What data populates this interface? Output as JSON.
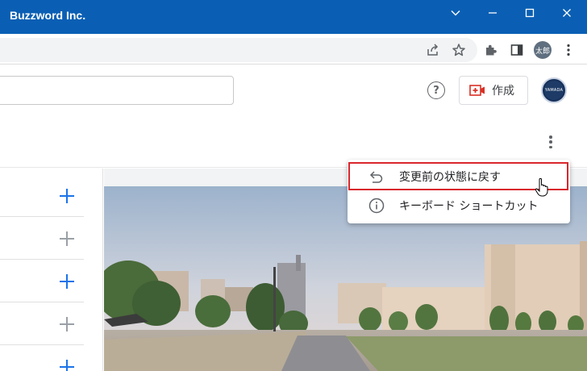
{
  "window": {
    "title": "Buzzword Inc."
  },
  "browser": {
    "profile_label": "太郎"
  },
  "header": {
    "create_label": "作成",
    "help_symbol": "?",
    "account_text": "YAMADA"
  },
  "menu": {
    "items": [
      {
        "label": "変更前の状態に戻す",
        "icon": "undo-icon"
      },
      {
        "label": "キーボード ショートカット",
        "icon": "info-icon"
      }
    ]
  },
  "colors": {
    "titlebar": "#0a5fb4",
    "accent": "#1a73e8",
    "highlight": "#d9262c"
  }
}
